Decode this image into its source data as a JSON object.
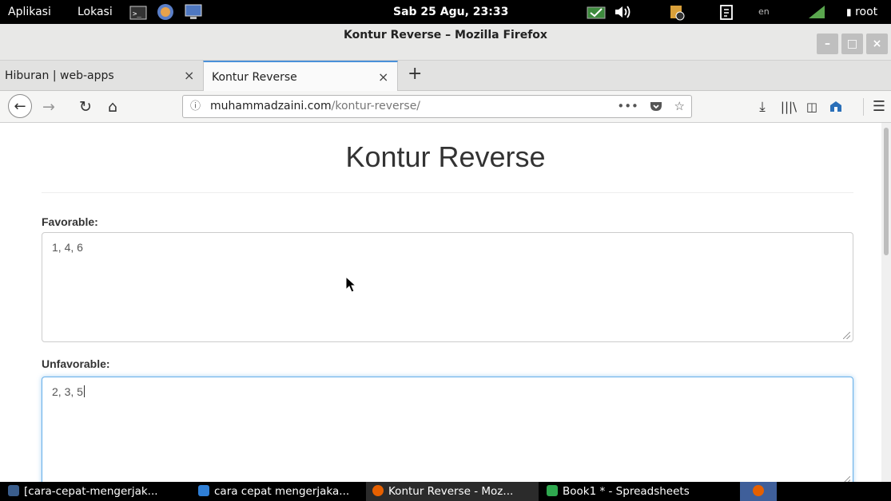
{
  "system_panel": {
    "applications": "Aplikasi",
    "places": "Lokasi",
    "clock": "Sab 25 Agu, 23:33",
    "keyboard_layout": "en",
    "user": "root"
  },
  "window": {
    "title": "Kontur Reverse – Mozilla Firefox"
  },
  "tabs": [
    {
      "label": "Hiburan | web-apps",
      "active": false
    },
    {
      "label": "Kontur Reverse",
      "active": true
    }
  ],
  "tab_close_glyph": "×",
  "new_tab_glyph": "+",
  "navbar": {
    "url_domain": "muhammadzaini.com",
    "url_path": "/kontur-reverse/",
    "page_actions": "•••"
  },
  "page": {
    "heading": "Kontur Reverse",
    "favorable_label": "Favorable:",
    "favorable_value": "1, 4, 6",
    "unfavorable_label": "Unfavorable:",
    "unfavorable_value": "2, 3, 5"
  },
  "taskbar": [
    {
      "label": "[cara-cepat-mengerjak...",
      "icon": "folder-icon",
      "color": "#3a5d8c"
    },
    {
      "label": "cara cepat mengerjaka...",
      "icon": "writer-icon",
      "color": "#2f7fd6"
    },
    {
      "label": "Kontur Reverse - Moz...",
      "icon": "firefox-icon",
      "color": "#e66000",
      "active": true
    },
    {
      "label": "Book1 * - Spreadsheets",
      "icon": "spreadsheet-icon",
      "color": "#2fa84f"
    }
  ],
  "colors": {
    "focus_border": "#66afe9",
    "active_tab_accent": "#4a90d9"
  }
}
